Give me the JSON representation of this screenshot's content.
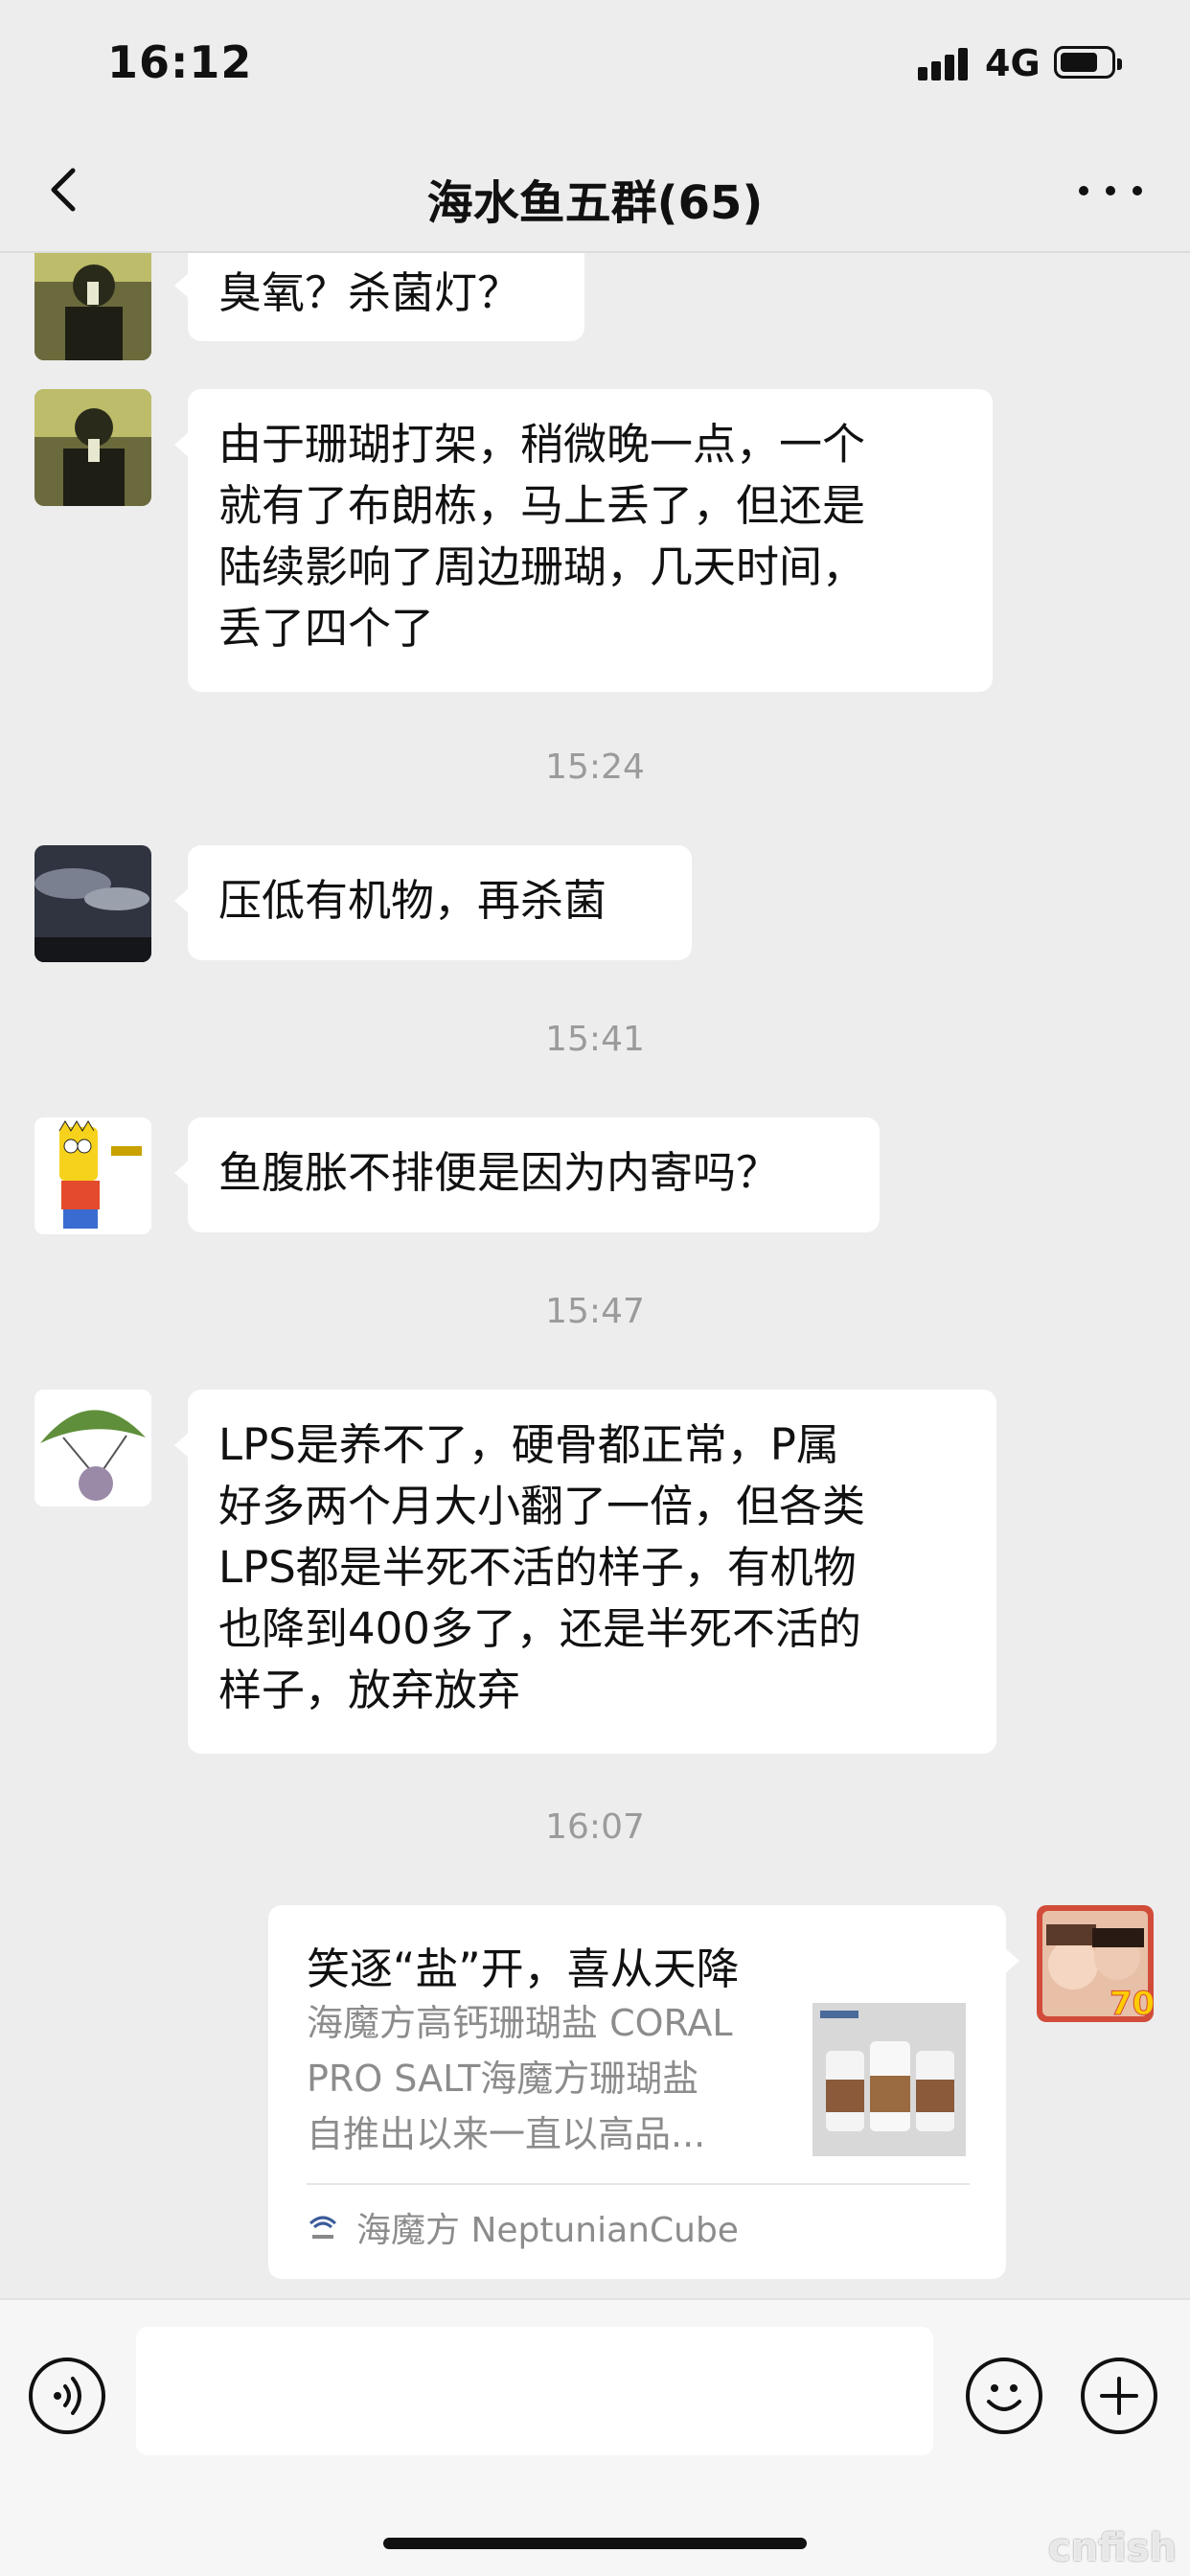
{
  "status_bar": {
    "time": "16:12",
    "network": "4G"
  },
  "nav": {
    "title": "海水鱼五群(65)"
  },
  "messages": [
    {
      "text": "臭氧？杀菌灯？"
    },
    {
      "text": "由于珊瑚打架，稍微晚一点，一个\n就有了布朗栋，马上丢了，但还是\n陆续影响了周边珊瑚，几天时间，\n丢了四个了"
    },
    {
      "time": "15:24"
    },
    {
      "text": "压低有机物，再杀菌"
    },
    {
      "time": "15:41"
    },
    {
      "text": "鱼腹胀不排便是因为内寄吗？"
    },
    {
      "time": "15:47"
    },
    {
      "text": "LPS是养不了，硬骨都正常，P属\n好多两个月大小翻了一倍，但各类\nLPS都是半死不活的样子，有机物\n也降到400多了，还是半死不活的\n样子，放弃放弃"
    },
    {
      "time": "16:07"
    },
    {
      "card": {
        "title": "笑逐“盐”开，喜从天降",
        "description": "海魔方高钙珊瑚盐 CORAL\nPRO SALT海魔方珊瑚盐\n自推出以来一直以高品...",
        "source": "海魔方 NeptunianCube"
      }
    }
  ],
  "avatars": {
    "boy_photo": "boy-photo-avatar",
    "cloud_sky": "cloudy-sky-avatar",
    "bart": "bart-cartoon-avatar",
    "leaf": "leaf-globe-avatar",
    "self": "kids-selfie-avatar",
    "self_badge": "70"
  },
  "input": {
    "placeholder": ""
  },
  "watermark": "cnfish",
  "colors": {
    "background": "#ededed",
    "bubble": "#ffffff",
    "timestamp": "#9b9b9b"
  }
}
